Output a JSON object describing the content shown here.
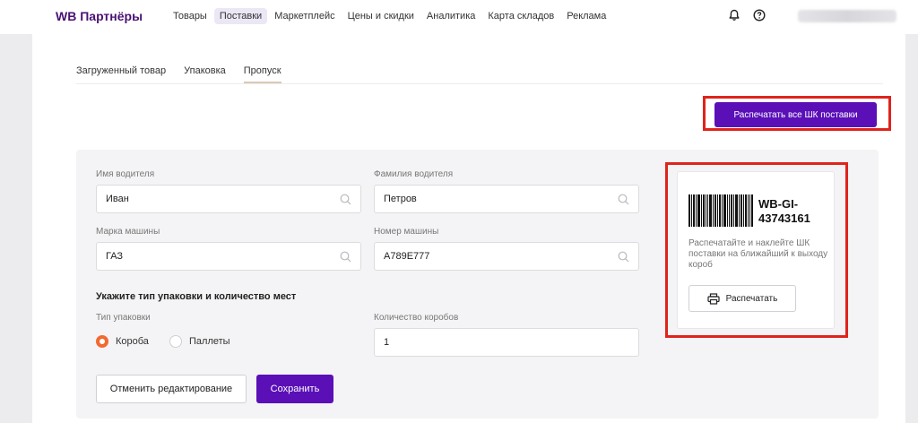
{
  "header": {
    "logo": "WB Партнёры",
    "nav": [
      {
        "label": "Товары",
        "active": false
      },
      {
        "label": "Поставки",
        "active": true
      },
      {
        "label": "Маркетплейс",
        "active": false
      },
      {
        "label": "Цены и скидки",
        "active": false
      },
      {
        "label": "Аналитика",
        "active": false
      },
      {
        "label": "Карта складов",
        "active": false
      },
      {
        "label": "Реклама",
        "active": false
      }
    ],
    "icons": [
      "bell-icon",
      "help-icon"
    ]
  },
  "tabs": [
    {
      "label": "Загруженный товар",
      "active": false
    },
    {
      "label": "Упаковка",
      "active": false
    },
    {
      "label": "Пропуск",
      "active": true
    }
  ],
  "actions": {
    "print_all_label": "Распечатать все ШК поставки"
  },
  "form": {
    "driver_first_name_label": "Имя водителя",
    "driver_first_name_value": "Иван",
    "driver_last_name_label": "Фамилия водителя",
    "driver_last_name_value": "Петров",
    "car_brand_label": "Марка машины",
    "car_brand_value": "ГАЗ",
    "car_number_label": "Номер машины",
    "car_number_value": "А789Е777",
    "packaging_section_title": "Укажите тип упаковки и количество мест",
    "packaging_type_label": "Тип упаковки",
    "packaging_options": [
      {
        "label": "Короба",
        "selected": true
      },
      {
        "label": "Паллеты",
        "selected": false
      }
    ],
    "box_count_label": "Количество коробов",
    "box_count_value": "1",
    "cancel_label": "Отменить редактирование",
    "save_label": "Сохранить"
  },
  "barcode_card": {
    "code_line1": "WB-GI-",
    "code_line2": "43743161",
    "hint": "Распечатайте и наклейте ШК поставки на ближайший к выходу короб",
    "print_label": "Распечатать"
  },
  "colors": {
    "brand": "#481173",
    "primary_button": "#5a0fb7",
    "highlight_frame": "#e0231b",
    "radio_selected": "#f26a31"
  }
}
